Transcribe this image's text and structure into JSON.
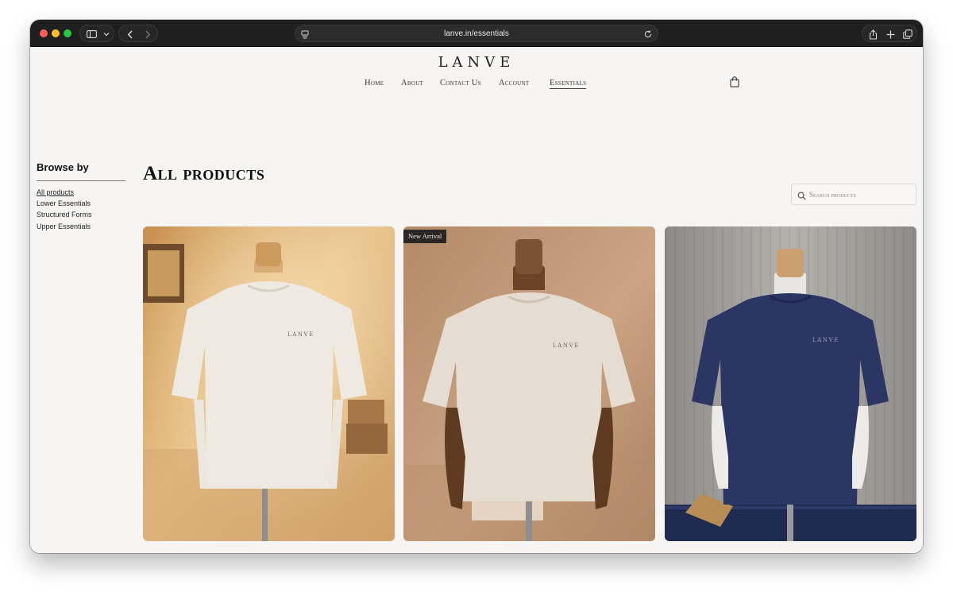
{
  "browser": {
    "url": "lanve.in/essentials"
  },
  "site": {
    "logo": "LANVE",
    "nav": [
      "Home",
      "About",
      "Contact Us",
      "Account",
      "Essentials"
    ],
    "active_nav": "Essentials"
  },
  "sidebar": {
    "title": "Browse by",
    "links": [
      "All products",
      "Lower Essentials",
      "Structured Forms",
      "Upper Essentials"
    ],
    "active": "All products"
  },
  "main": {
    "heading": "All products",
    "search": {
      "placeholder": "Search products",
      "value": ""
    }
  },
  "products": [
    {
      "badge": "",
      "shirt_color": "#efeae1",
      "print": "LANVE"
    },
    {
      "badge": "New Arrival",
      "shirt_color": "#e5ddd1",
      "print": "LANVE"
    },
    {
      "badge": "",
      "shirt_color": "#2c3665",
      "print": "LANVE"
    }
  ],
  "colors": {
    "page_bg": "#f6f5f3",
    "titlebar": "#1f1f1f",
    "text": "#111111"
  }
}
